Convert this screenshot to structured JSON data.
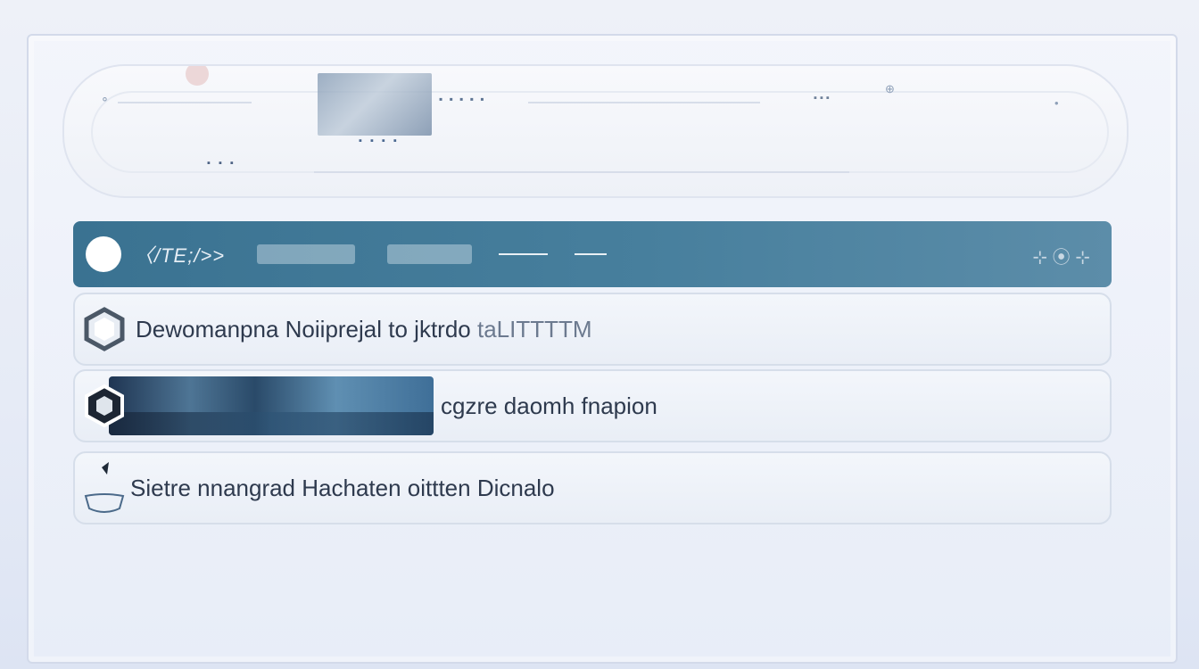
{
  "header": {
    "title_text": "▪ ▪ ▪ ▪ ▪",
    "meta_text": "▪ ▪ ▪ ▪",
    "sub_text": "▪ ▪ ▪",
    "right_text": "▪ ▪ ▪"
  },
  "list": {
    "selected": {
      "label": "〈/TE;/>>",
      "icons": "⊹ ⦿ ⊹"
    },
    "items": [
      {
        "icon": "hexagon-shield-icon",
        "text_main": "Dewomanpna Noiiprejal to jktrdo",
        "text_faint": "taLITTTTM"
      },
      {
        "icon": "hexagon-shield-icon",
        "has_thumbnail": true,
        "text_main": "cgzre daomh fnapion"
      },
      {
        "icon": "bowl-icon",
        "text_main": "Sietre nnangrad Hachaten oittten Dicnalo"
      }
    ]
  },
  "colors": {
    "selected_row": "#3a7291",
    "row_background": "#f3f6fb",
    "row_border": "#d6deea",
    "text": "#2e3a4e"
  }
}
